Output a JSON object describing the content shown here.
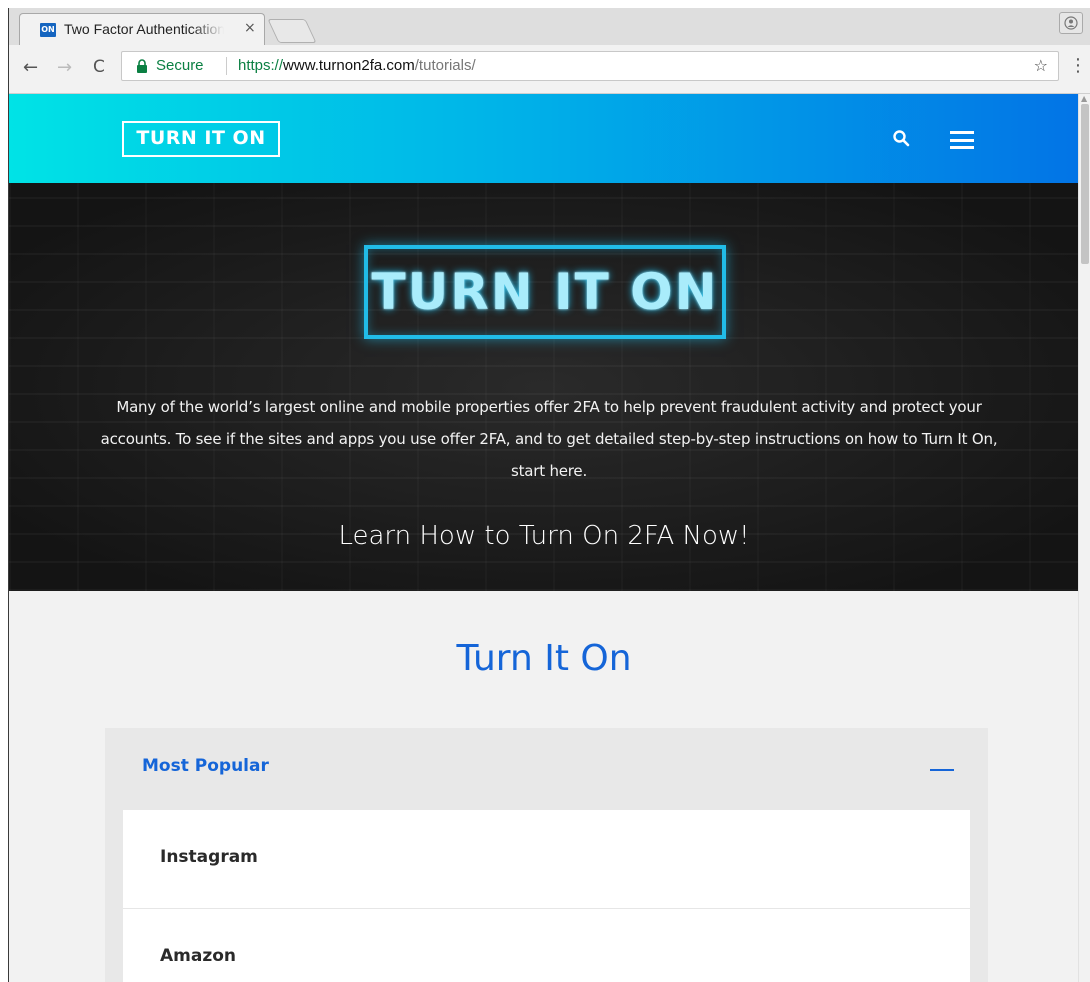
{
  "browser": {
    "tab": {
      "favicon": "ON",
      "title": "Two Factor Authentication",
      "close": "×"
    },
    "toolbar": {
      "back": "←",
      "forward": "→",
      "reload": "C",
      "secure_label": "Secure",
      "url_scheme": "https://",
      "url_host": "www.turnon2fa.com",
      "url_path": "/tutorials/",
      "bookmark": "☆",
      "menu": "⋮"
    }
  },
  "header": {
    "logo": "TURN IT ON",
    "icons": [
      "search-icon",
      "hamburger-menu-icon"
    ],
    "gradient_colors": [
      "#00e3e6",
      "#0274e6"
    ]
  },
  "hero": {
    "logo": "TURN IT ON",
    "description": "Many of the world’s largest online and mobile properties offer 2FA to help prevent fraudulent activity and protect your accounts. To see if the sites and apps you use offer 2FA, and to get detailed step-by-step instructions on how to Turn It On, start here.",
    "cta": "Learn How to Turn On 2FA Now!"
  },
  "main": {
    "title": "Turn It On",
    "accordion": {
      "title": "Most Popular",
      "toggle": "—",
      "items": [
        "Instagram",
        "Amazon"
      ]
    }
  },
  "colors": {
    "accent": "#1565d8",
    "neon": "#21bce8"
  }
}
